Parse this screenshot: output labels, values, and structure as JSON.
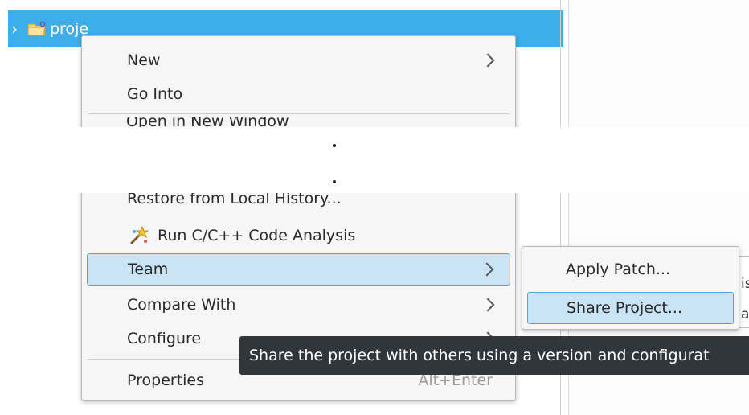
{
  "explorer": {
    "project_label": "proje"
  },
  "context_menu": {
    "items": [
      {
        "label": "New",
        "submenu": true
      },
      {
        "label": "Go Into",
        "submenu": false
      },
      {
        "label": "Open in New Window",
        "submenu": false
      },
      {
        "label": "Restore from Local History...",
        "submenu": false
      },
      {
        "label": "Run C/C++ Code Analysis",
        "submenu": false,
        "icon": "code-analysis-icon"
      },
      {
        "label": "Team",
        "submenu": true,
        "active": true
      },
      {
        "label": "Compare With",
        "submenu": true
      },
      {
        "label": "Configure",
        "submenu": true
      },
      {
        "label": "Properties",
        "shortcut": "Alt+Enter"
      }
    ]
  },
  "team_submenu": {
    "items": [
      {
        "label": "Apply Patch..."
      },
      {
        "label": "Share Project...",
        "active": true
      }
    ]
  },
  "tooltip": {
    "text": "Share the project with others using a version and configurat"
  },
  "behind_text": {
    "line1": "is",
    "line2": "ay"
  },
  "colors": {
    "selection": "#3daee9",
    "menu_highlight": "#c9e4f5",
    "menu_highlight_border": "#4fa6dc",
    "tooltip_bg": "#31363b"
  }
}
